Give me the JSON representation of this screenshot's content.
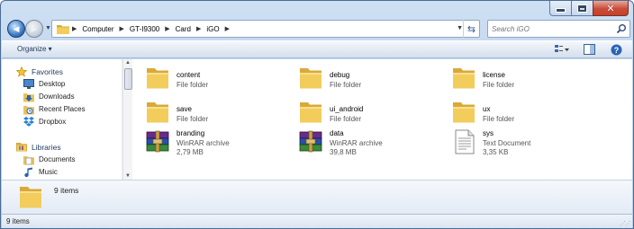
{
  "window": {
    "caption": {
      "minimize": "",
      "maximize": "",
      "close": "✕"
    }
  },
  "nav": {
    "back_glyph": "◀",
    "forward_glyph": "▶",
    "recent_glyph": "▼",
    "breadcrumbs": [
      "Computer",
      "GT-I9300",
      "Card",
      "iGO"
    ],
    "refresh_glyph": "⇆",
    "search_placeholder": "Search iGO"
  },
  "toolbar": {
    "organize_label": "Organize ▾"
  },
  "sidebar": {
    "favorites_label": "Favorites",
    "favorites": [
      "Desktop",
      "Downloads",
      "Recent Places",
      "Dropbox"
    ],
    "libraries_label": "Libraries",
    "libraries": [
      "Documents",
      "Music"
    ]
  },
  "files": [
    {
      "name": "content",
      "type": "File folder",
      "size": "",
      "icon": "folder-icon"
    },
    {
      "name": "debug",
      "type": "File folder",
      "size": "",
      "icon": "folder-icon"
    },
    {
      "name": "license",
      "type": "File folder",
      "size": "",
      "icon": "folder-icon"
    },
    {
      "name": "save",
      "type": "File folder",
      "size": "",
      "icon": "folder-icon"
    },
    {
      "name": "ui_android",
      "type": "File folder",
      "size": "",
      "icon": "folder-icon"
    },
    {
      "name": "ux",
      "type": "File folder",
      "size": "",
      "icon": "folder-icon"
    },
    {
      "name": "branding",
      "type": "WinRAR archive",
      "size": "2,79 MB",
      "icon": "winrar-archive-icon"
    },
    {
      "name": "data",
      "type": "WinRAR archive",
      "size": "39,8 MB",
      "icon": "winrar-archive-icon"
    },
    {
      "name": "sys",
      "type": "Text Document",
      "size": "3,35 KB",
      "icon": "text-document-icon"
    }
  ],
  "details": {
    "count": "9 items"
  },
  "status": {
    "text": "9 items"
  },
  "colors": {
    "folder": "#f2cd5c",
    "folder_dark": "#d9a93a",
    "accent": "#3d7cc9"
  }
}
